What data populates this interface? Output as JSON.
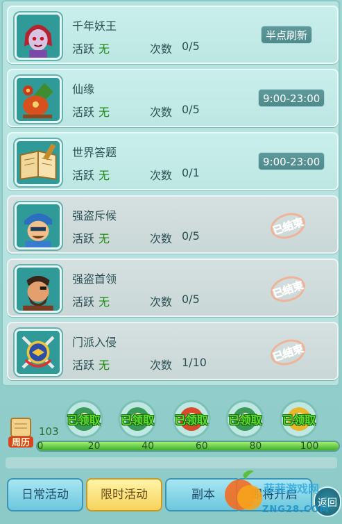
{
  "activities": [
    {
      "name": "千年妖王",
      "active_label": "活跃",
      "active_value": "无",
      "count_label": "次数",
      "count_value": "0/5",
      "time": "半点刷新",
      "ended": false,
      "icon": "demon-king-icon"
    },
    {
      "name": "仙缘",
      "active_label": "活跃",
      "active_value": "无",
      "count_label": "次数",
      "count_value": "0/5",
      "time": "9:00-23:00",
      "ended": false,
      "icon": "fortune-pouch-icon"
    },
    {
      "name": "世界答题",
      "active_label": "活跃",
      "active_value": "无",
      "count_label": "次数",
      "count_value": "0/1",
      "time": "9:00-23:00",
      "ended": false,
      "icon": "book-icon"
    },
    {
      "name": "强盗斥候",
      "active_label": "活跃",
      "active_value": "无",
      "count_label": "次数",
      "count_value": "0/5",
      "status": "已结束",
      "ended": true,
      "icon": "bandit-scout-icon"
    },
    {
      "name": "强盗首领",
      "active_label": "活跃",
      "active_value": "无",
      "count_label": "次数",
      "count_value": "0/5",
      "status": "已结束",
      "ended": true,
      "icon": "bandit-leader-icon"
    },
    {
      "name": "门派入侵",
      "active_label": "活跃",
      "active_value": "无",
      "count_label": "次数",
      "count_value": "1/10",
      "status": "已结束",
      "ended": true,
      "icon": "sect-invasion-icon"
    }
  ],
  "progress": {
    "current": "103",
    "calendar_label": "周历",
    "fill_fraction": 1.0,
    "ticks": [
      "0",
      "20",
      "40",
      "60",
      "80",
      "100"
    ],
    "rewards": [
      {
        "label": "已领取"
      },
      {
        "label": "已领取"
      },
      {
        "label": "已领取"
      },
      {
        "label": "已领取"
      },
      {
        "label": "已领取"
      }
    ]
  },
  "tabs": [
    {
      "label": "日常活动",
      "active": false
    },
    {
      "label": "限时活动",
      "active": true
    },
    {
      "label": "副本",
      "active": false
    },
    {
      "label": "即将开启",
      "active": false
    }
  ],
  "back_label": "返回",
  "watermark": {
    "text": "菲菲游戏网",
    "url": "ZNG28.COM"
  },
  "colors": {
    "active_green": "#1d8a12",
    "stamp_red": "#e0572a",
    "tab_active": "#f7d35c"
  }
}
